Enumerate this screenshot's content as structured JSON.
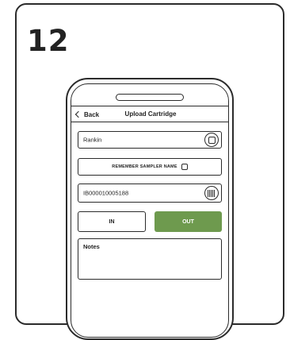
{
  "step": {
    "number": "12"
  },
  "nav": {
    "back_label": "Back",
    "title": "Upload Cartridge"
  },
  "sampler_name": {
    "value": "Rankin",
    "action_icon": "square-icon"
  },
  "remember_sampler": {
    "label": "REMEMBER SAMPLER NAME",
    "checked": false
  },
  "cartridge_id": {
    "value": "IB000010005188",
    "action_icon": "barcode-icon"
  },
  "direction": {
    "in_label": "IN",
    "out_label": "OUT",
    "selected": "OUT"
  },
  "notes": {
    "label": "Notes",
    "value": ""
  },
  "colors": {
    "accent": "#6e9a4e",
    "outline": "#2b2b2b"
  }
}
